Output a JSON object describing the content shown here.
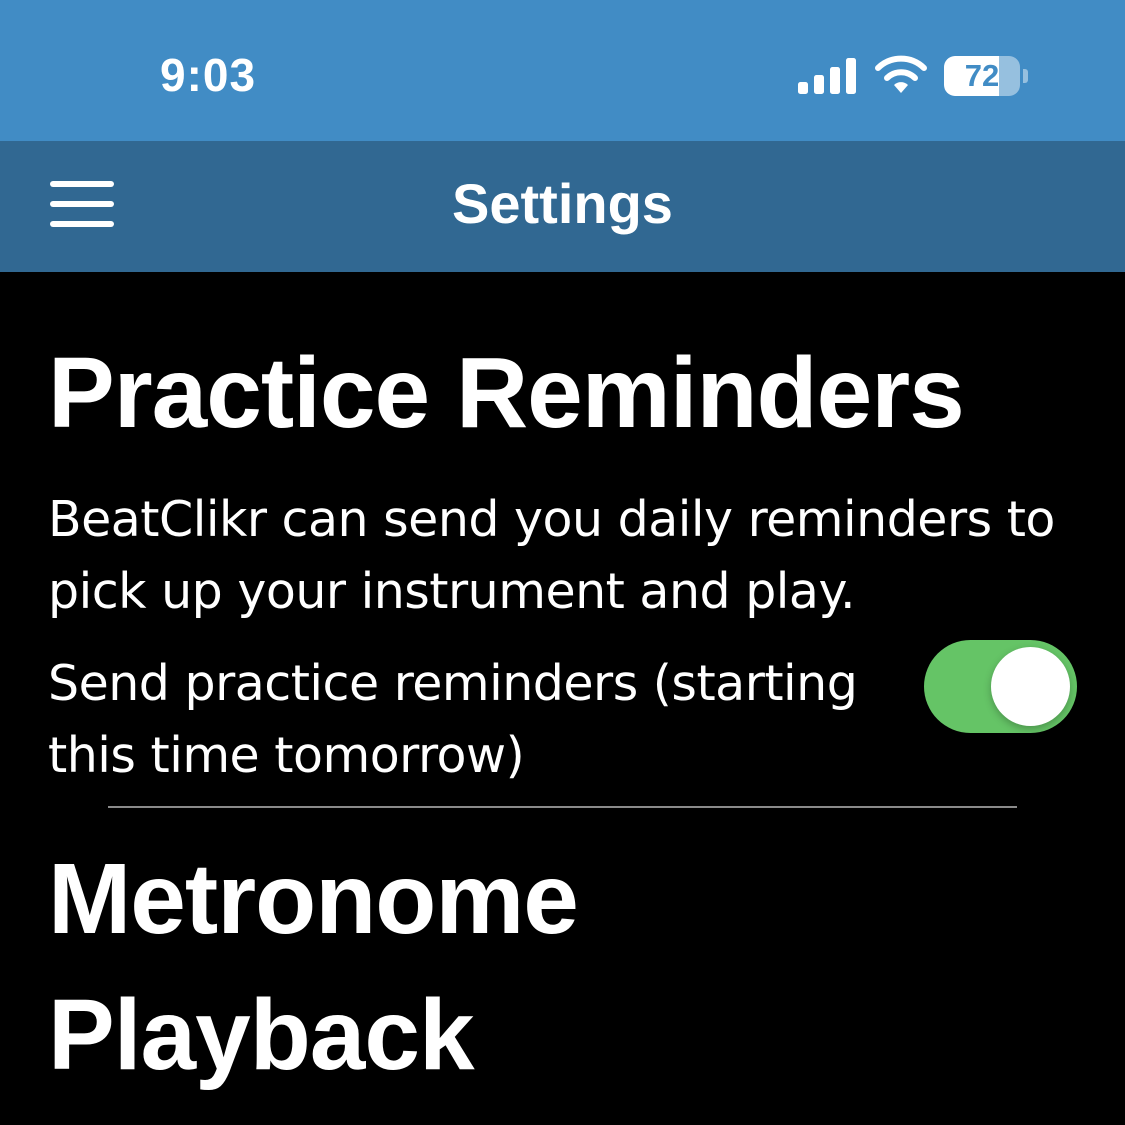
{
  "status_bar": {
    "time": "9:03",
    "battery_level": 72,
    "battery_label": "72",
    "signal_icon": "cellular-signal-icon",
    "wifi_icon": "wifi-icon",
    "color": "#418cc5"
  },
  "nav_bar": {
    "title": "Settings",
    "menu_icon": "hamburger-menu-icon",
    "color": "#316892"
  },
  "practice_reminders": {
    "heading": "Practice Reminders",
    "description": "BeatClikr can send you daily reminders to pick up your instrument and play.",
    "toggle_label": "Send practice reminders (starting this time tomorrow)",
    "toggle_on": true,
    "toggle_color": "#65c466"
  },
  "metronome_playback": {
    "heading_line1": "Metronome",
    "heading_line2": "Playback"
  }
}
